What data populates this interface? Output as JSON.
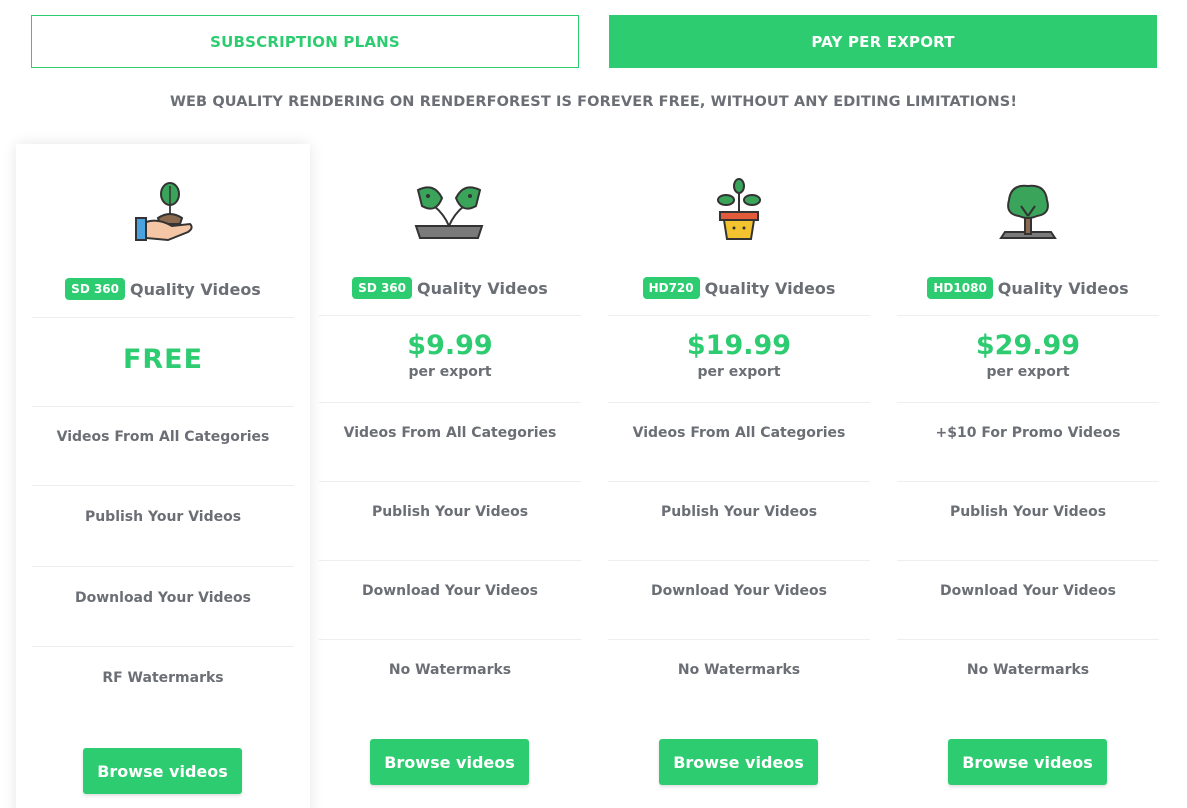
{
  "tabs": {
    "subscription": "SUBSCRIPTION PLANS",
    "pay_per_export": "PAY PER EXPORT"
  },
  "tagline": "WEB QUALITY RENDERING ON RENDERFOREST IS FOREVER FREE, WITHOUT ANY EDITING LIMITATIONS!",
  "colors": {
    "accent": "#2ecc71",
    "text": "#6b6f75"
  },
  "plans": [
    {
      "icon": "hand-seedling-icon",
      "badge": "SD 360",
      "quality": "Quality Videos",
      "price": "FREE",
      "features": [
        "Videos From All Categories",
        "Publish Your Videos",
        "Download Your Videos",
        "RF Watermarks"
      ],
      "button": "Browse videos"
    },
    {
      "icon": "sprouting-leaves-icon",
      "badge": "SD 360",
      "quality": "Quality Videos",
      "price": "$9.99",
      "per": "per export",
      "features": [
        "Videos From All Categories",
        "Publish Your Videos",
        "Download Your Videos",
        "No Watermarks"
      ],
      "button": "Browse videos"
    },
    {
      "icon": "potted-plant-icon",
      "badge": "HD720",
      "quality": "Quality Videos",
      "price": "$19.99",
      "per": "per export",
      "features": [
        "Videos From All Categories",
        "Publish Your Videos",
        "Download Your Videos",
        "No Watermarks"
      ],
      "button": "Browse videos"
    },
    {
      "icon": "tree-icon",
      "badge": "HD1080",
      "quality": "Quality Videos",
      "price": "$29.99",
      "per": "per export",
      "features": [
        "+$10 For Promo Videos",
        "Publish Your Videos",
        "Download Your Videos",
        "No Watermarks"
      ],
      "button": "Browse videos"
    }
  ]
}
